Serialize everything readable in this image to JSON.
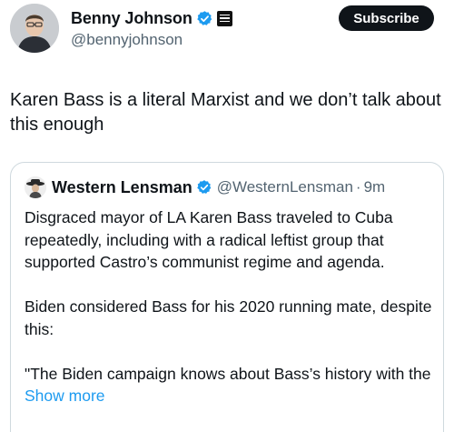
{
  "author": {
    "display_name": "Benny Johnson",
    "handle": "@bennyjohnson",
    "avatar_icon": "avatar-photo",
    "verified_icon": "verified-badge-icon",
    "affiliate_icon": "affiliate-badge-icon"
  },
  "subscribe": {
    "label": "Subscribe"
  },
  "tweet": {
    "text": "Karen Bass is a literal Marxist and we don’t talk about this enough"
  },
  "quote": {
    "display_name": "Western Lensman",
    "handle": "@WesternLensman",
    "separator": "·",
    "time": "9m",
    "paragraphs": [
      "Disgraced mayor of LA Karen Bass traveled to Cuba repeatedly, including with a radical leftist group that supported Castro’s communist regime and agenda.",
      "Biden considered Bass for his 2020 running mate, despite this:"
    ],
    "last_paragraph_text": "\"The Biden campaign knows about Bass’s history with the",
    "show_more": "Show more"
  },
  "colors": {
    "text": "#0f1419",
    "secondary": "#536471",
    "accent": "#1d9bf0",
    "border": "#cfd9de",
    "button_bg": "#0f1419"
  }
}
